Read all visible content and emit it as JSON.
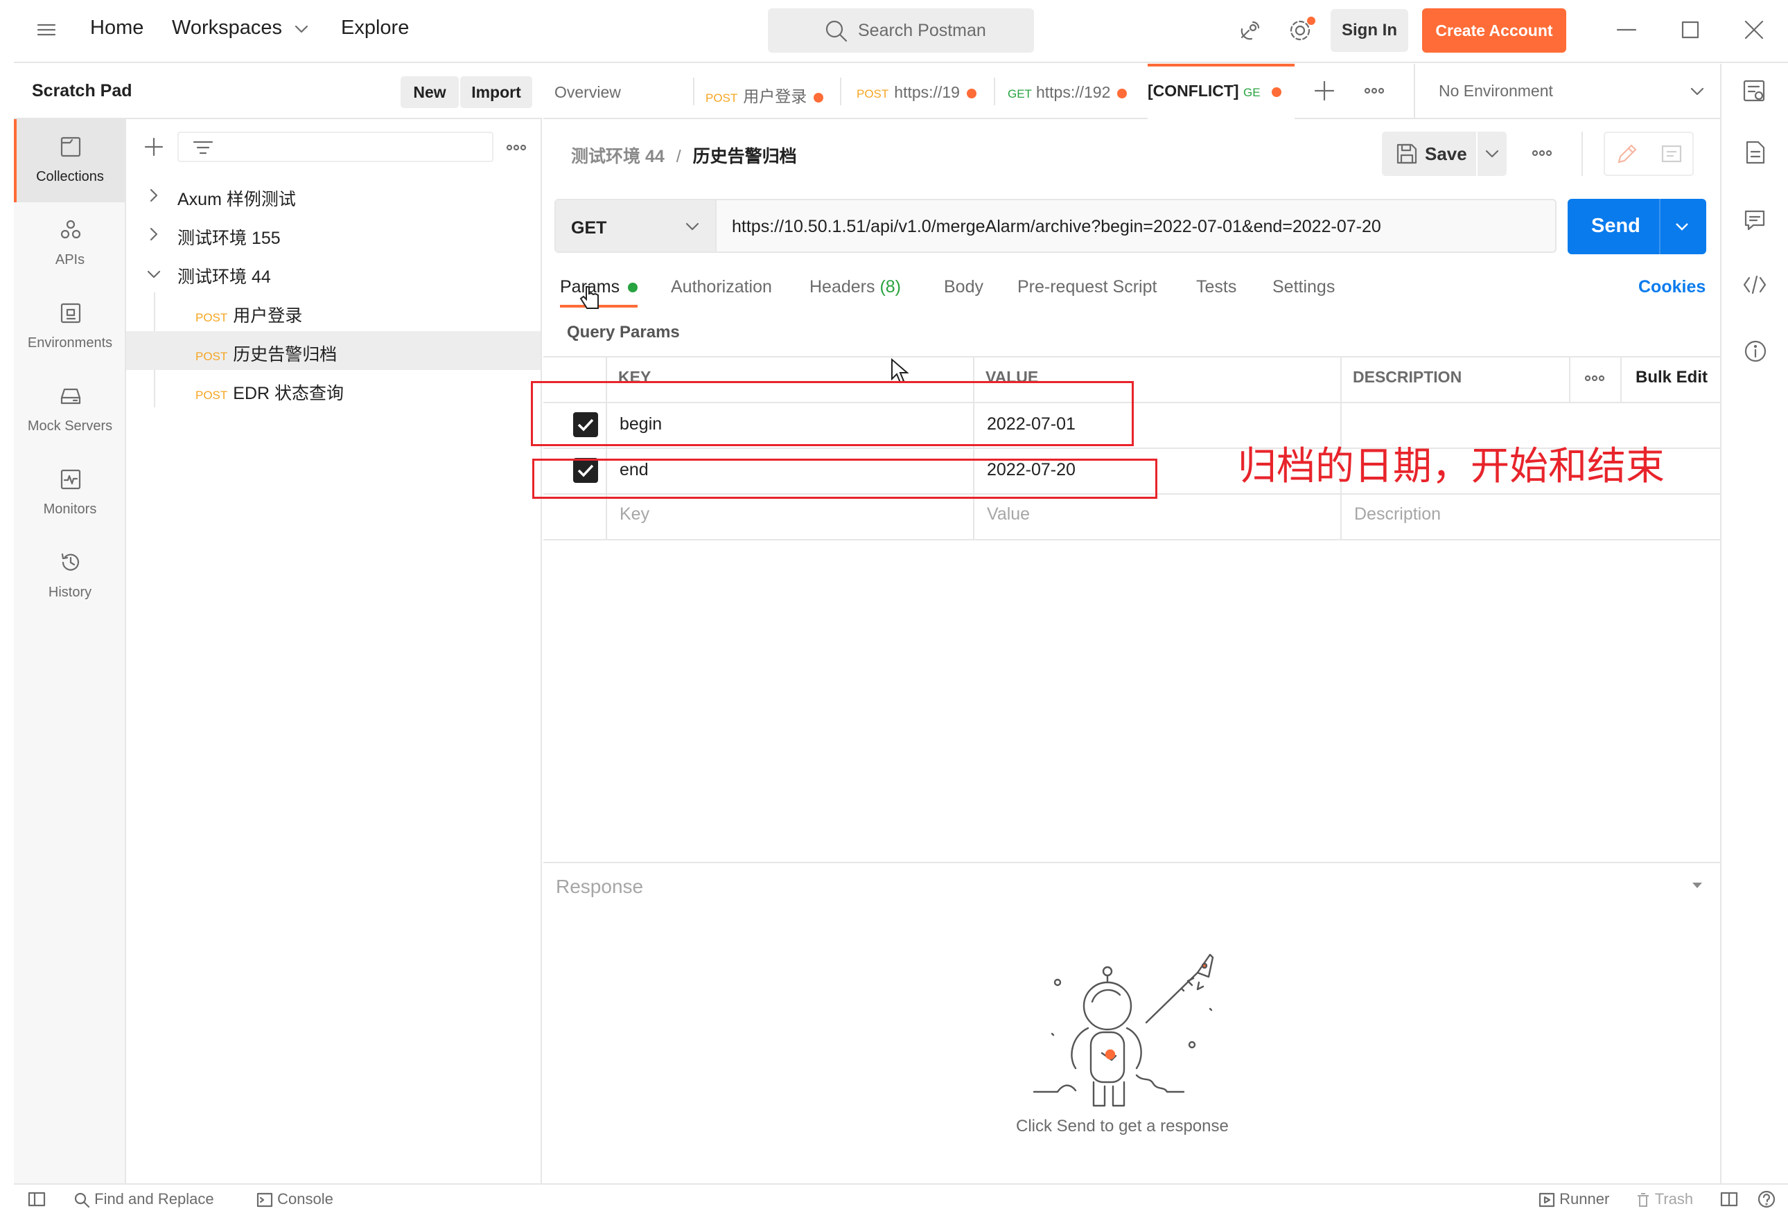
{
  "header": {
    "home": "Home",
    "workspaces": "Workspaces",
    "explore": "Explore",
    "search_placeholder": "Search Postman",
    "sign_in": "Sign In",
    "create_account": "Create Account"
  },
  "scratch": {
    "title": "Scratch Pad",
    "new": "New",
    "import": "Import"
  },
  "rail": [
    {
      "label": "Collections",
      "icon": "collections-icon"
    },
    {
      "label": "APIs",
      "icon": "apis-icon"
    },
    {
      "label": "Environments",
      "icon": "environments-icon"
    },
    {
      "label": "Mock Servers",
      "icon": "mock-servers-icon"
    },
    {
      "label": "Monitors",
      "icon": "monitors-icon"
    },
    {
      "label": "History",
      "icon": "history-icon"
    }
  ],
  "tree": {
    "c1": "Axum 样例测试",
    "c2": "测试环境 155",
    "c3": "测试环境 44",
    "r1_method": "POST",
    "r1": "用户登录",
    "r2_method": "POST",
    "r2": "历史告警归档",
    "r3_method": "POST",
    "r3": "EDR 状态查询"
  },
  "tabs": {
    "overview": "Overview",
    "t1_method": "POST",
    "t1": "用户登录",
    "t2_method": "POST",
    "t2": "https://19",
    "t3_method": "GET",
    "t3": "https://192",
    "t4": "[CONFLICT]",
    "t4_method": "GE",
    "environment": "No Environment"
  },
  "breadcrumb": {
    "parent": "测试环境 44",
    "sep": "/",
    "current": "历史告警归档"
  },
  "actions": {
    "save": "Save"
  },
  "request": {
    "method": "GET",
    "url": "https://10.50.1.51/api/v1.0/mergeAlarm/archive?begin=2022-07-01&end=2022-07-20",
    "send": "Send"
  },
  "subtabs": {
    "params": "Params",
    "authorization": "Authorization",
    "headers": "Headers",
    "headers_count": "(8)",
    "body": "Body",
    "prerequest": "Pre-request Script",
    "tests": "Tests",
    "settings": "Settings",
    "cookies": "Cookies"
  },
  "params": {
    "title": "Query Params",
    "col_key": "KEY",
    "col_value": "VALUE",
    "col_description": "DESCRIPTION",
    "bulk_edit": "Bulk Edit",
    "rows": [
      {
        "key": "begin",
        "value": "2022-07-01",
        "checked": true
      },
      {
        "key": "end",
        "value": "2022-07-20",
        "checked": true
      }
    ],
    "placeholder_key": "Key",
    "placeholder_value": "Value",
    "placeholder_description": "Description"
  },
  "annotation": "归档的日期，开始和结束",
  "response": {
    "title": "Response",
    "empty": "Click Send to get a response"
  },
  "status": {
    "find_replace": "Find and Replace",
    "console": "Console",
    "runner": "Runner",
    "trash": "Trash"
  },
  "colors": {
    "accent": "#ff6c37",
    "send": "#097bed",
    "annotation": "#e8242b",
    "post": "#f5a623",
    "get": "#27a340"
  }
}
